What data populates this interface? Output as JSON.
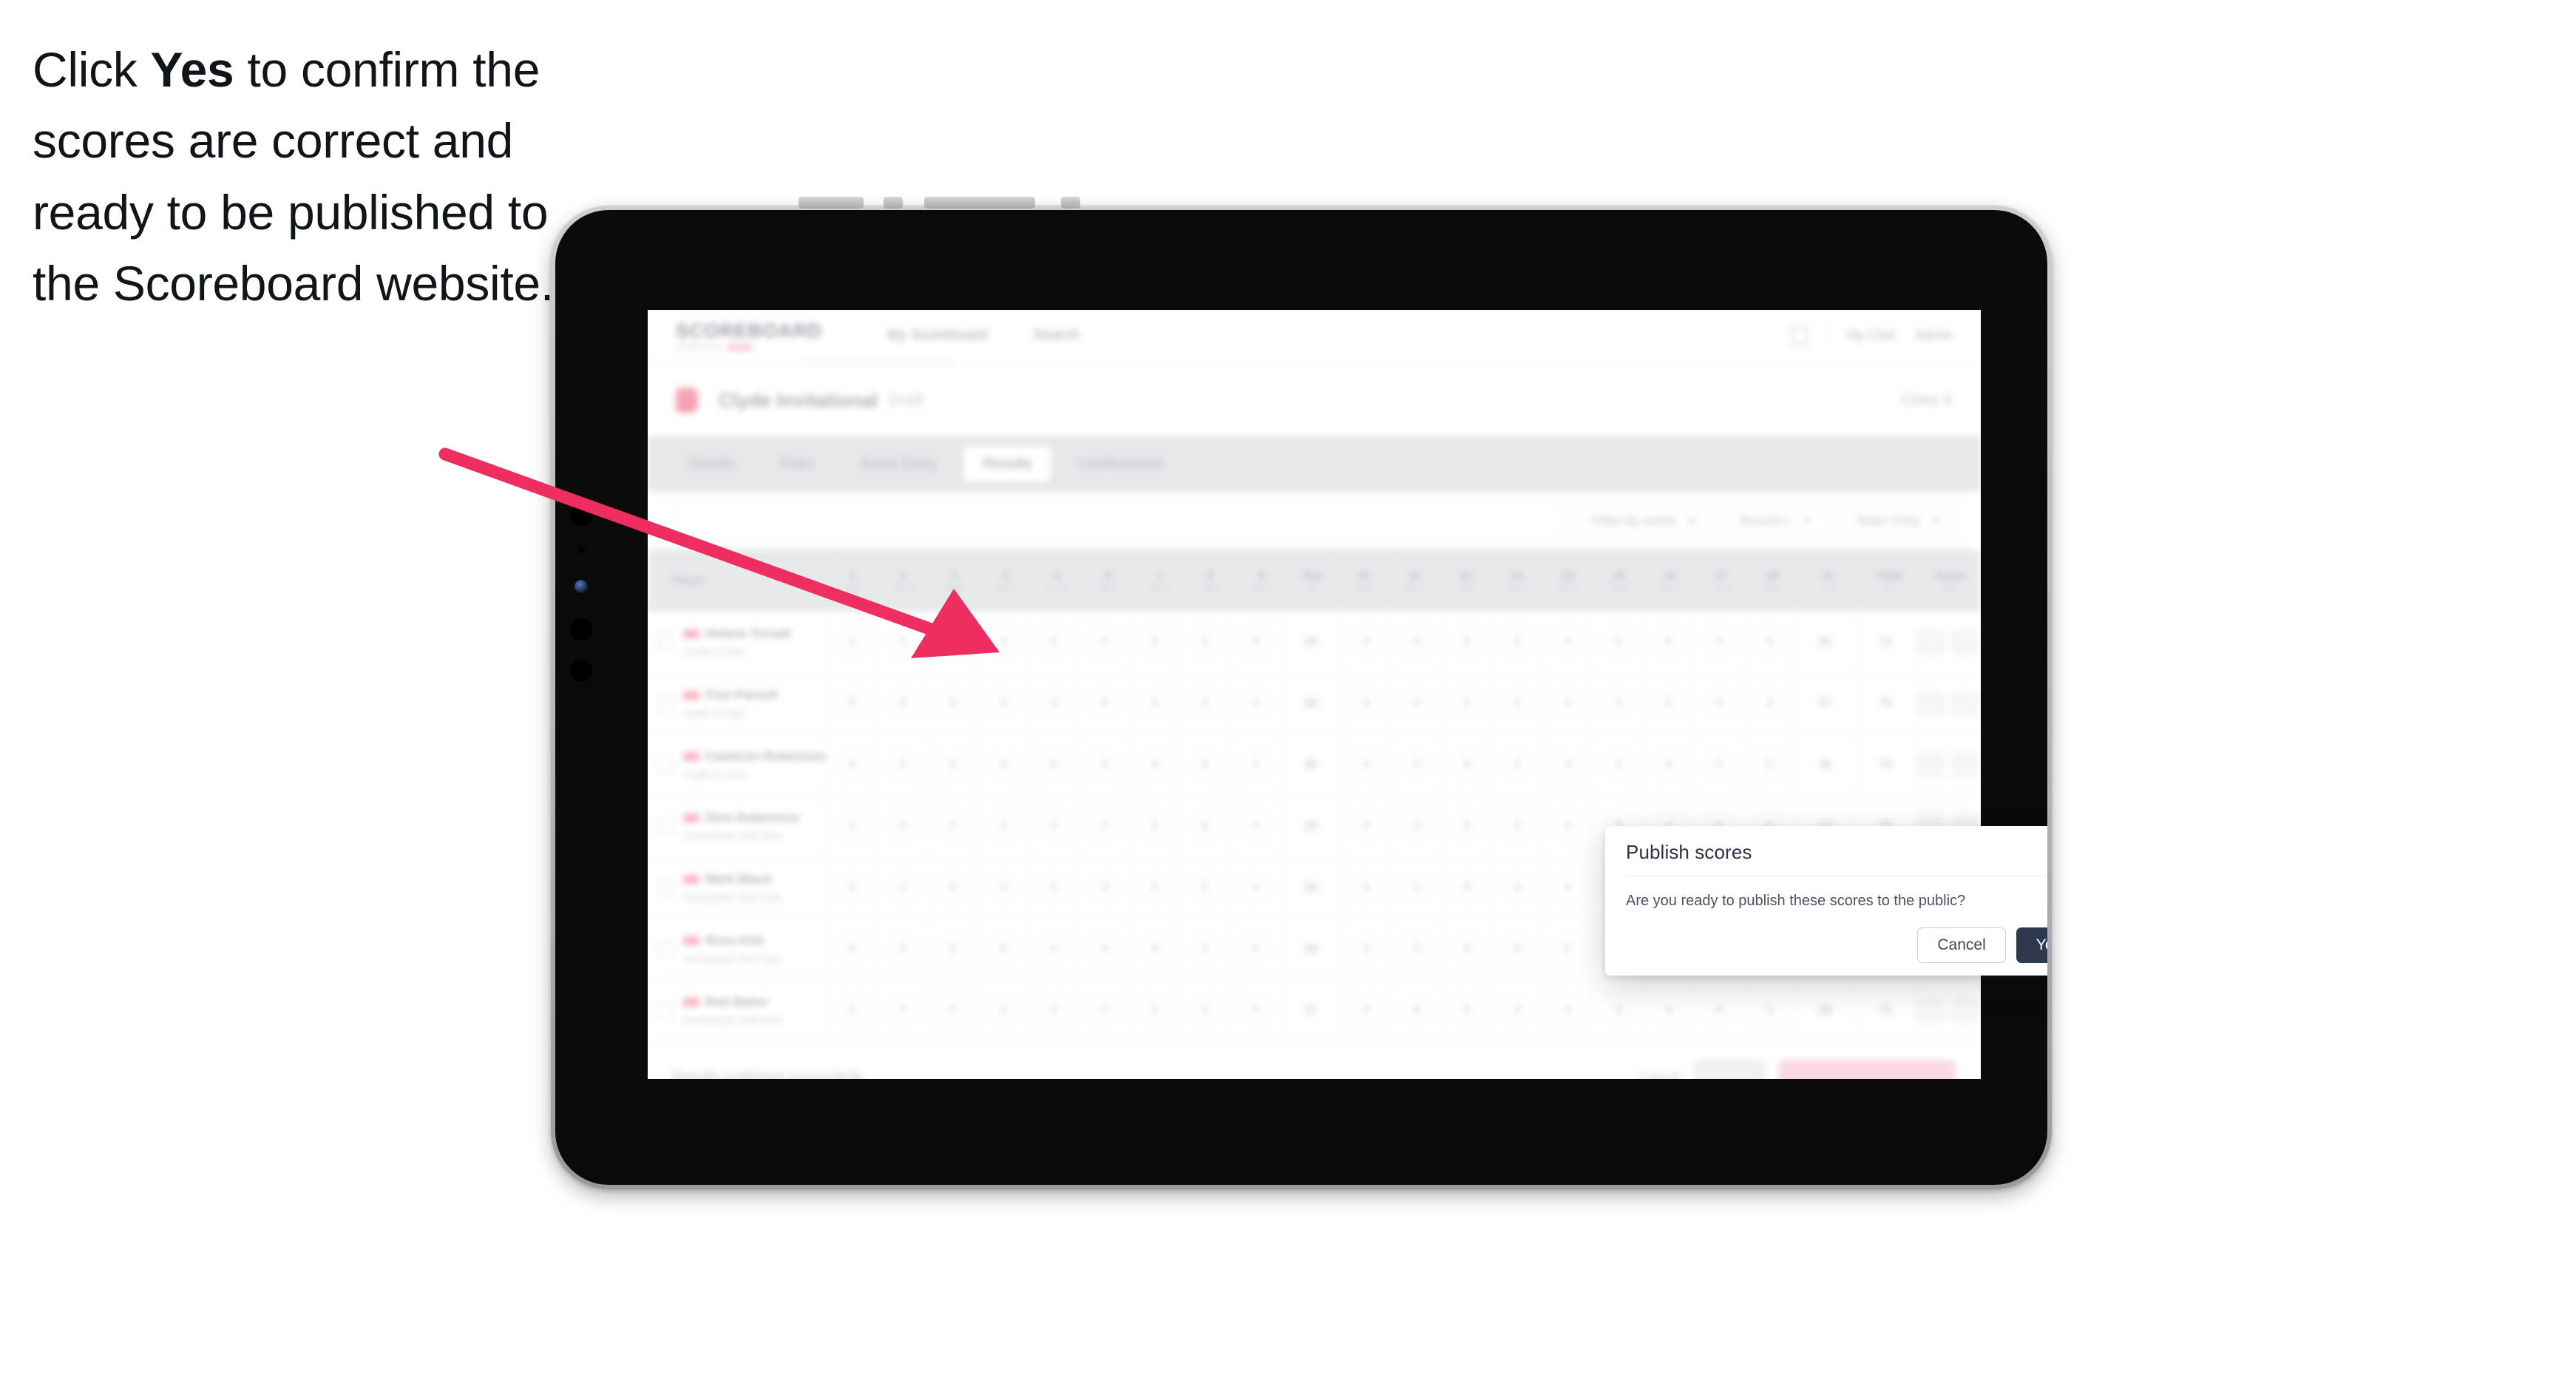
{
  "caption": {
    "before": "Click ",
    "bold": "Yes",
    "after": " to confirm the scores are correct and ready to be published to the Scoreboard website."
  },
  "colors": {
    "accent_pink": "#ED2E5F",
    "modal_primary": "#2D394C",
    "brand_pink": "#F4879F",
    "tablet_frame": "#B8B8BA",
    "screen_black": "#0A0A0A"
  },
  "modal": {
    "title": "Publish scores",
    "body": "Are you ready to publish these scores to the public?",
    "close_icon": "×",
    "cancel_label": "Cancel",
    "confirm_label": "Yes"
  },
  "app": {
    "brand": {
      "word": "SCOREBOARD",
      "sub": "powered by"
    },
    "topnav_links": [
      "My Scoreboard",
      "Search"
    ],
    "topnav_right": [
      "My Club",
      "Admin"
    ],
    "event": {
      "name": "Clyde Invitational",
      "status": "Draft",
      "right": "Close X"
    },
    "tabs": [
      {
        "label": "Details",
        "active": false
      },
      {
        "label": "Pairs",
        "active": false
      },
      {
        "label": "Score Entry",
        "active": false
      },
      {
        "label": "Results",
        "active": true
      },
      {
        "label": "Leaderboard",
        "active": false
      }
    ],
    "search_placeholder": "Search",
    "filters": [
      {
        "label": "Filter by event"
      },
      {
        "label": "Round 1"
      },
      {
        "label": "Team Only"
      }
    ],
    "table": {
      "player_header": "Player",
      "hole_columns": [
        {
          "num": "1",
          "sub": "Par 4"
        },
        {
          "num": "2",
          "sub": "Par 3"
        },
        {
          "num": "3",
          "sub": "Par 5"
        },
        {
          "num": "4",
          "sub": "Par 4"
        },
        {
          "num": "5",
          "sub": "Par 4"
        },
        {
          "num": "6",
          "sub": "Par 3"
        },
        {
          "num": "7",
          "sub": "Par 4"
        },
        {
          "num": "8",
          "sub": "Par 5"
        },
        {
          "num": "9",
          "sub": "Par 4"
        },
        {
          "num": "Out",
          "sub": "36"
        },
        {
          "num": "10",
          "sub": "Par 4"
        },
        {
          "num": "11",
          "sub": "Par 3"
        },
        {
          "num": "12",
          "sub": "Par 5"
        },
        {
          "num": "13",
          "sub": "Par 4"
        },
        {
          "num": "14",
          "sub": "Par 4"
        },
        {
          "num": "15",
          "sub": "Par 3"
        },
        {
          "num": "16",
          "sub": "Par 4"
        },
        {
          "num": "17",
          "sub": "Par 5"
        },
        {
          "num": "18",
          "sub": "Par 4"
        }
      ],
      "tail_columns": [
        {
          "num": "In",
          "sub": "36"
        },
        {
          "num": "Total",
          "sub": "72"
        },
        {
          "num": "Score",
          "sub": "Net"
        }
      ],
      "rows": [
        {
          "name": "Helena Torvalt",
          "club": "Clyde G Club",
          "scores": [
            "4",
            "3",
            "5",
            "4",
            "4",
            "3",
            "4",
            "5",
            "4"
          ],
          "out": "36",
          "in2": [
            "4",
            "3",
            "5",
            "4",
            "4",
            "3",
            "4",
            "5",
            "4"
          ],
          "in_total": "36",
          "total": "72",
          "score_a": "72",
          "score_b": "+0"
        },
        {
          "name": "Finn Parnell",
          "club": "Clyde G Club",
          "scores": [
            "5",
            "3",
            "5",
            "4",
            "4",
            "4",
            "4",
            "5",
            "4"
          ],
          "out": "38",
          "in2": [
            "4",
            "3",
            "5",
            "4",
            "4",
            "3",
            "5",
            "5",
            "4"
          ],
          "in_total": "37",
          "total": "75",
          "score_a": "75",
          "score_b": "+3"
        },
        {
          "name": "Cameron Robertson",
          "club": "Clyde G Club",
          "scores": [
            "4",
            "3",
            "6",
            "4",
            "5",
            "3",
            "4",
            "5",
            "4"
          ],
          "out": "38",
          "in2": [
            "4",
            "4",
            "5",
            "4",
            "4",
            "3",
            "4",
            "5",
            "5"
          ],
          "in_total": "38",
          "total": "76",
          "score_a": "76",
          "score_b": "+4"
        },
        {
          "name": "Dion Robertson",
          "club": "Sunnybank Golf Club",
          "scores": [
            "4",
            "4",
            "5",
            "4",
            "4",
            "3",
            "4",
            "6",
            "4"
          ],
          "out": "38",
          "in2": [
            "4",
            "3",
            "5",
            "5",
            "4",
            "3",
            "4",
            "5",
            "4"
          ],
          "in_total": "37",
          "total": "75",
          "score_a": "75",
          "score_b": "+3"
        },
        {
          "name": "Mark Black",
          "club": "Sunnybank Golf Club",
          "scores": [
            "5",
            "3",
            "5",
            "4",
            "4",
            "3",
            "5",
            "5",
            "4"
          ],
          "out": "38",
          "in2": [
            "4",
            "3",
            "6",
            "4",
            "4",
            "3",
            "4",
            "5",
            "4"
          ],
          "in_total": "37",
          "total": "75",
          "score_a": "75",
          "score_b": "+3"
        },
        {
          "name": "Ross Kirk",
          "club": "Sunnybank Golf Club",
          "scores": [
            "4",
            "3",
            "5",
            "5",
            "4",
            "4",
            "4",
            "5",
            "4"
          ],
          "out": "38",
          "in2": [
            "4",
            "3",
            "5",
            "4",
            "5",
            "3",
            "4",
            "5",
            "4"
          ],
          "in_total": "37",
          "total": "75",
          "score_a": "75",
          "score_b": "+3"
        },
        {
          "name": "Rob Baker",
          "club": "Sunnybank Golf Club",
          "scores": [
            "4",
            "3",
            "5",
            "4",
            "4",
            "3",
            "4",
            "5",
            "5"
          ],
          "out": "37",
          "in2": [
            "4",
            "4",
            "5",
            "4",
            "4",
            "3",
            "4",
            "6",
            "4"
          ],
          "in_total": "38",
          "total": "75",
          "score_a": "75",
          "score_b": "+3"
        }
      ]
    },
    "footer": {
      "note": "Results published successfully",
      "link_label": "Cancel",
      "secondary_label": "Save",
      "primary_label": "Publish to Scoreboard"
    }
  }
}
